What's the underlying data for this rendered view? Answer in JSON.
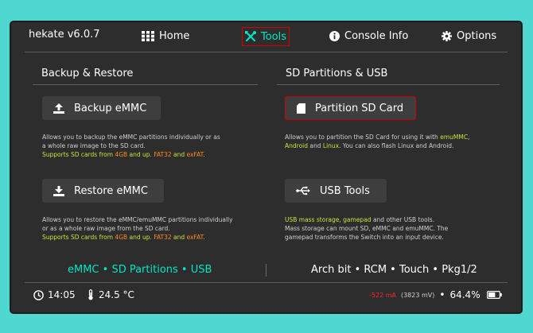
{
  "app": {
    "title": "hekate v6.0.7"
  },
  "nav": {
    "home": "Home",
    "tools": "Tools",
    "console_info": "Console Info",
    "options": "Options"
  },
  "left": {
    "section_title": "Backup & Restore",
    "backup_label": "Backup eMMC",
    "backup_desc_1": "Allows you to backup the eMMC partitions individually or as",
    "backup_desc_2": "a whole raw image to the SD card.",
    "supports_prefix": "Supports SD cards from ",
    "size_4gb": "4GB",
    "and_up": " and up. ",
    "fat32": "FAT32",
    "and": " and ",
    "exfat": "exFAT",
    "period": ".",
    "restore_label": "Restore eMMC",
    "restore_desc_1": "Allows you to restore the eMMC/emuMMC partitions individually",
    "restore_desc_2": "or as a whole raw image from the SD card."
  },
  "right": {
    "section_title": "SD Partitions & USB",
    "partition_label": "Partition SD Card",
    "partition_desc_1_prefix": "Allows you to partition the SD Card for using it with ",
    "emummc": "emuMMC",
    "comma": ",",
    "android": "Android",
    "and": " and ",
    "linux": "Linux",
    "partition_desc_2_suffix": ". You can also flash Linux and Android.",
    "usb_label": "USB Tools",
    "usb_mass_storage": "USB mass storage",
    "comma_space": ", ",
    "gamepad": "gamepad",
    "usb_desc_1_suffix": " and other USB tools.",
    "usb_desc_2": "Mass storage can mount SD, eMMC and emuMMC. The",
    "usb_desc_3": "gamepad transforms the Switch into an input device."
  },
  "footer": {
    "left_note": "eMMC • SD Partitions • USB",
    "right_note": "Arch bit • RCM • Touch • Pkg1/2"
  },
  "status": {
    "time": "14:05",
    "temperature": "24.5 °C",
    "current": "-522 mA",
    "voltage": "(3823 mV)",
    "battery_percent": "64.4%",
    "battery_level": 0.644
  },
  "colors": {
    "accent": "#00e6c4",
    "highlight": "#c9e23a",
    "orange": "#ff8a1a",
    "selection": "#d40000"
  }
}
